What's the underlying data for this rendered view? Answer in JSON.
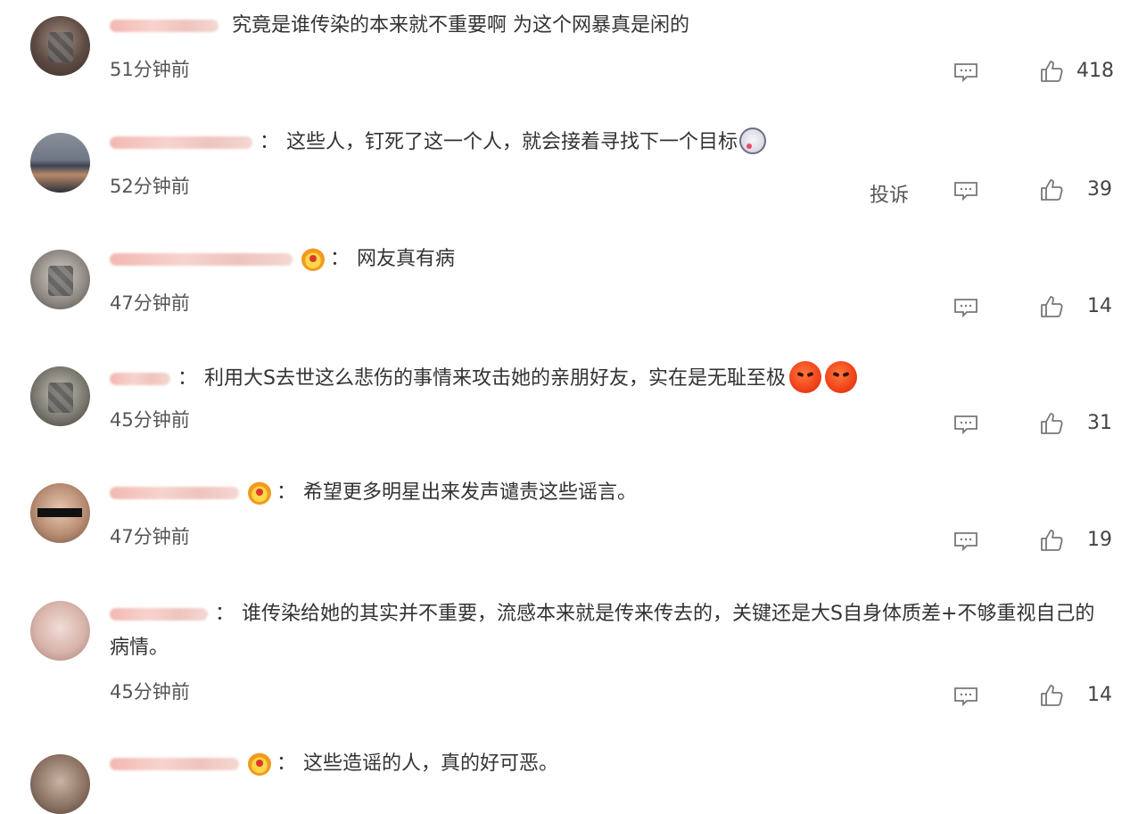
{
  "comments": [
    {
      "text": "究竟是谁传染的本来就不重要啊 为这个网暴真是闲的",
      "time": "51分钟前",
      "likes": "418",
      "has_vip": false,
      "has_report": false,
      "emoji": []
    },
    {
      "text": "这些人，钉死了这一个人，就会接着寻找下一个目标",
      "time": "52分钟前",
      "likes": "39",
      "has_vip": false,
      "has_report": true,
      "report_label": "投诉",
      "emoji": [
        "dizzy-emoji"
      ]
    },
    {
      "text": "网友真有病",
      "time": "47分钟前",
      "likes": "14",
      "has_vip": true,
      "has_report": false,
      "emoji": []
    },
    {
      "text": "利用大S去世这么悲伤的事情来攻击她的亲朋好友，实在是无耻至极",
      "time": "45分钟前",
      "likes": "31",
      "has_vip": false,
      "has_report": false,
      "emoji": [
        "angry-emoji",
        "angry-emoji"
      ]
    },
    {
      "text": "希望更多明星出来发声谴责这些谣言。",
      "time": "47分钟前",
      "likes": "19",
      "has_vip": true,
      "has_report": false,
      "emoji": []
    },
    {
      "text": "谁传染给她的其实并不重要，流感本来就是传来传去的，关键还是大S自身体质差+不够重视自己的病情。",
      "time": "45分钟前",
      "likes": "14",
      "has_vip": false,
      "has_report": false,
      "emoji": []
    },
    {
      "text": "这些造谣的人，真的好可恶。",
      "time": "",
      "likes": "",
      "has_vip": true,
      "has_report": false,
      "emoji": []
    }
  ],
  "separator": "：",
  "colors": {
    "text": "#333333",
    "meta": "#555555",
    "icon": "#777777",
    "vip_gold": "#f29a1d"
  }
}
